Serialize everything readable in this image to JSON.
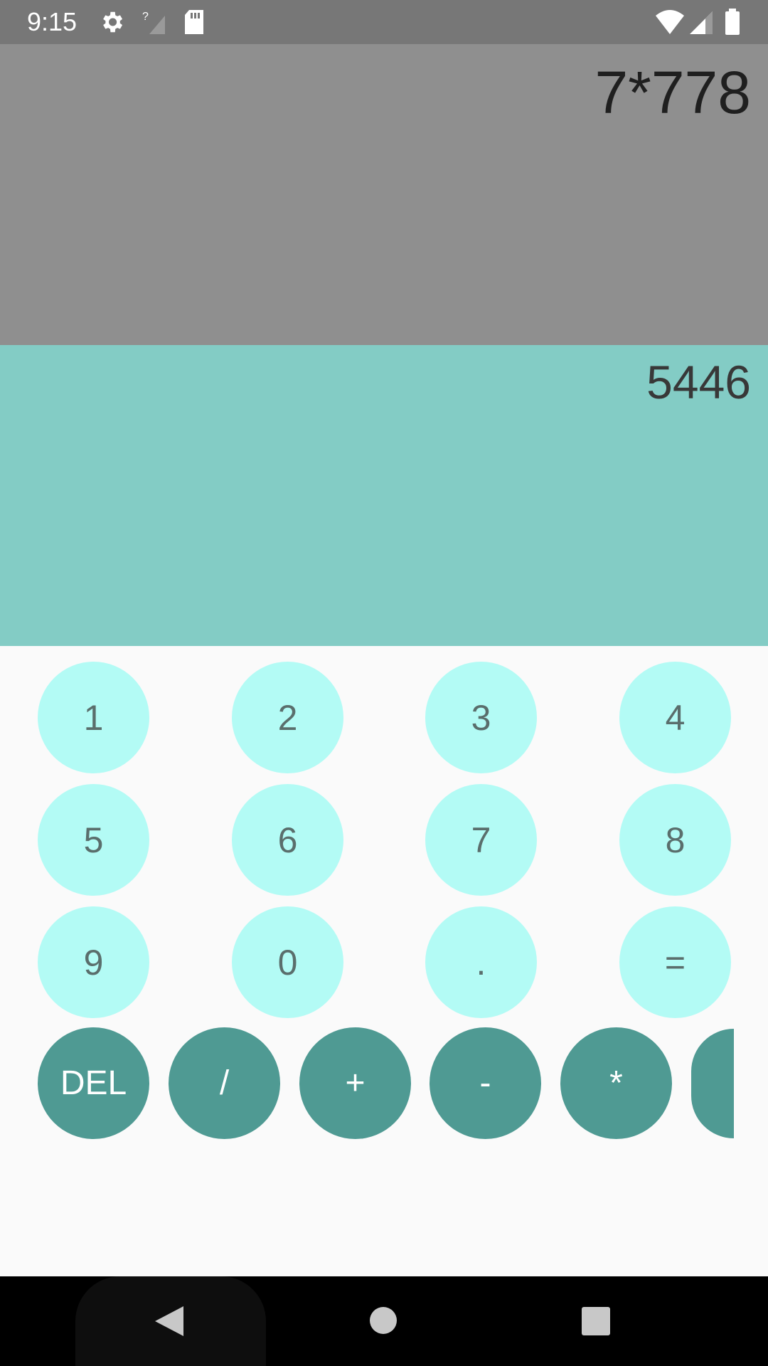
{
  "status_bar": {
    "time": "9:15",
    "icons": [
      "settings-gear-icon",
      "no-signal-icon",
      "sd-card-icon",
      "wifi-icon",
      "cell-signal-icon",
      "battery-icon"
    ],
    "color": "#777777"
  },
  "display": {
    "expression": "7*778",
    "result": "5446",
    "expression_bg": "#8f8f8f",
    "result_bg": "#83ccc5"
  },
  "keypad": {
    "rows": [
      [
        "1",
        "2",
        "3",
        "4"
      ],
      [
        "5",
        "6",
        "7",
        "8"
      ],
      [
        "9",
        "0",
        ".",
        "="
      ]
    ],
    "operators": [
      "DEL",
      "/",
      "+",
      "-",
      "*",
      ""
    ],
    "light_key_color": "#b3fbf5",
    "dark_key_color": "#4f9a93"
  },
  "nav_bar": {
    "icons": [
      "back-icon",
      "home-icon",
      "recents-icon"
    ]
  }
}
